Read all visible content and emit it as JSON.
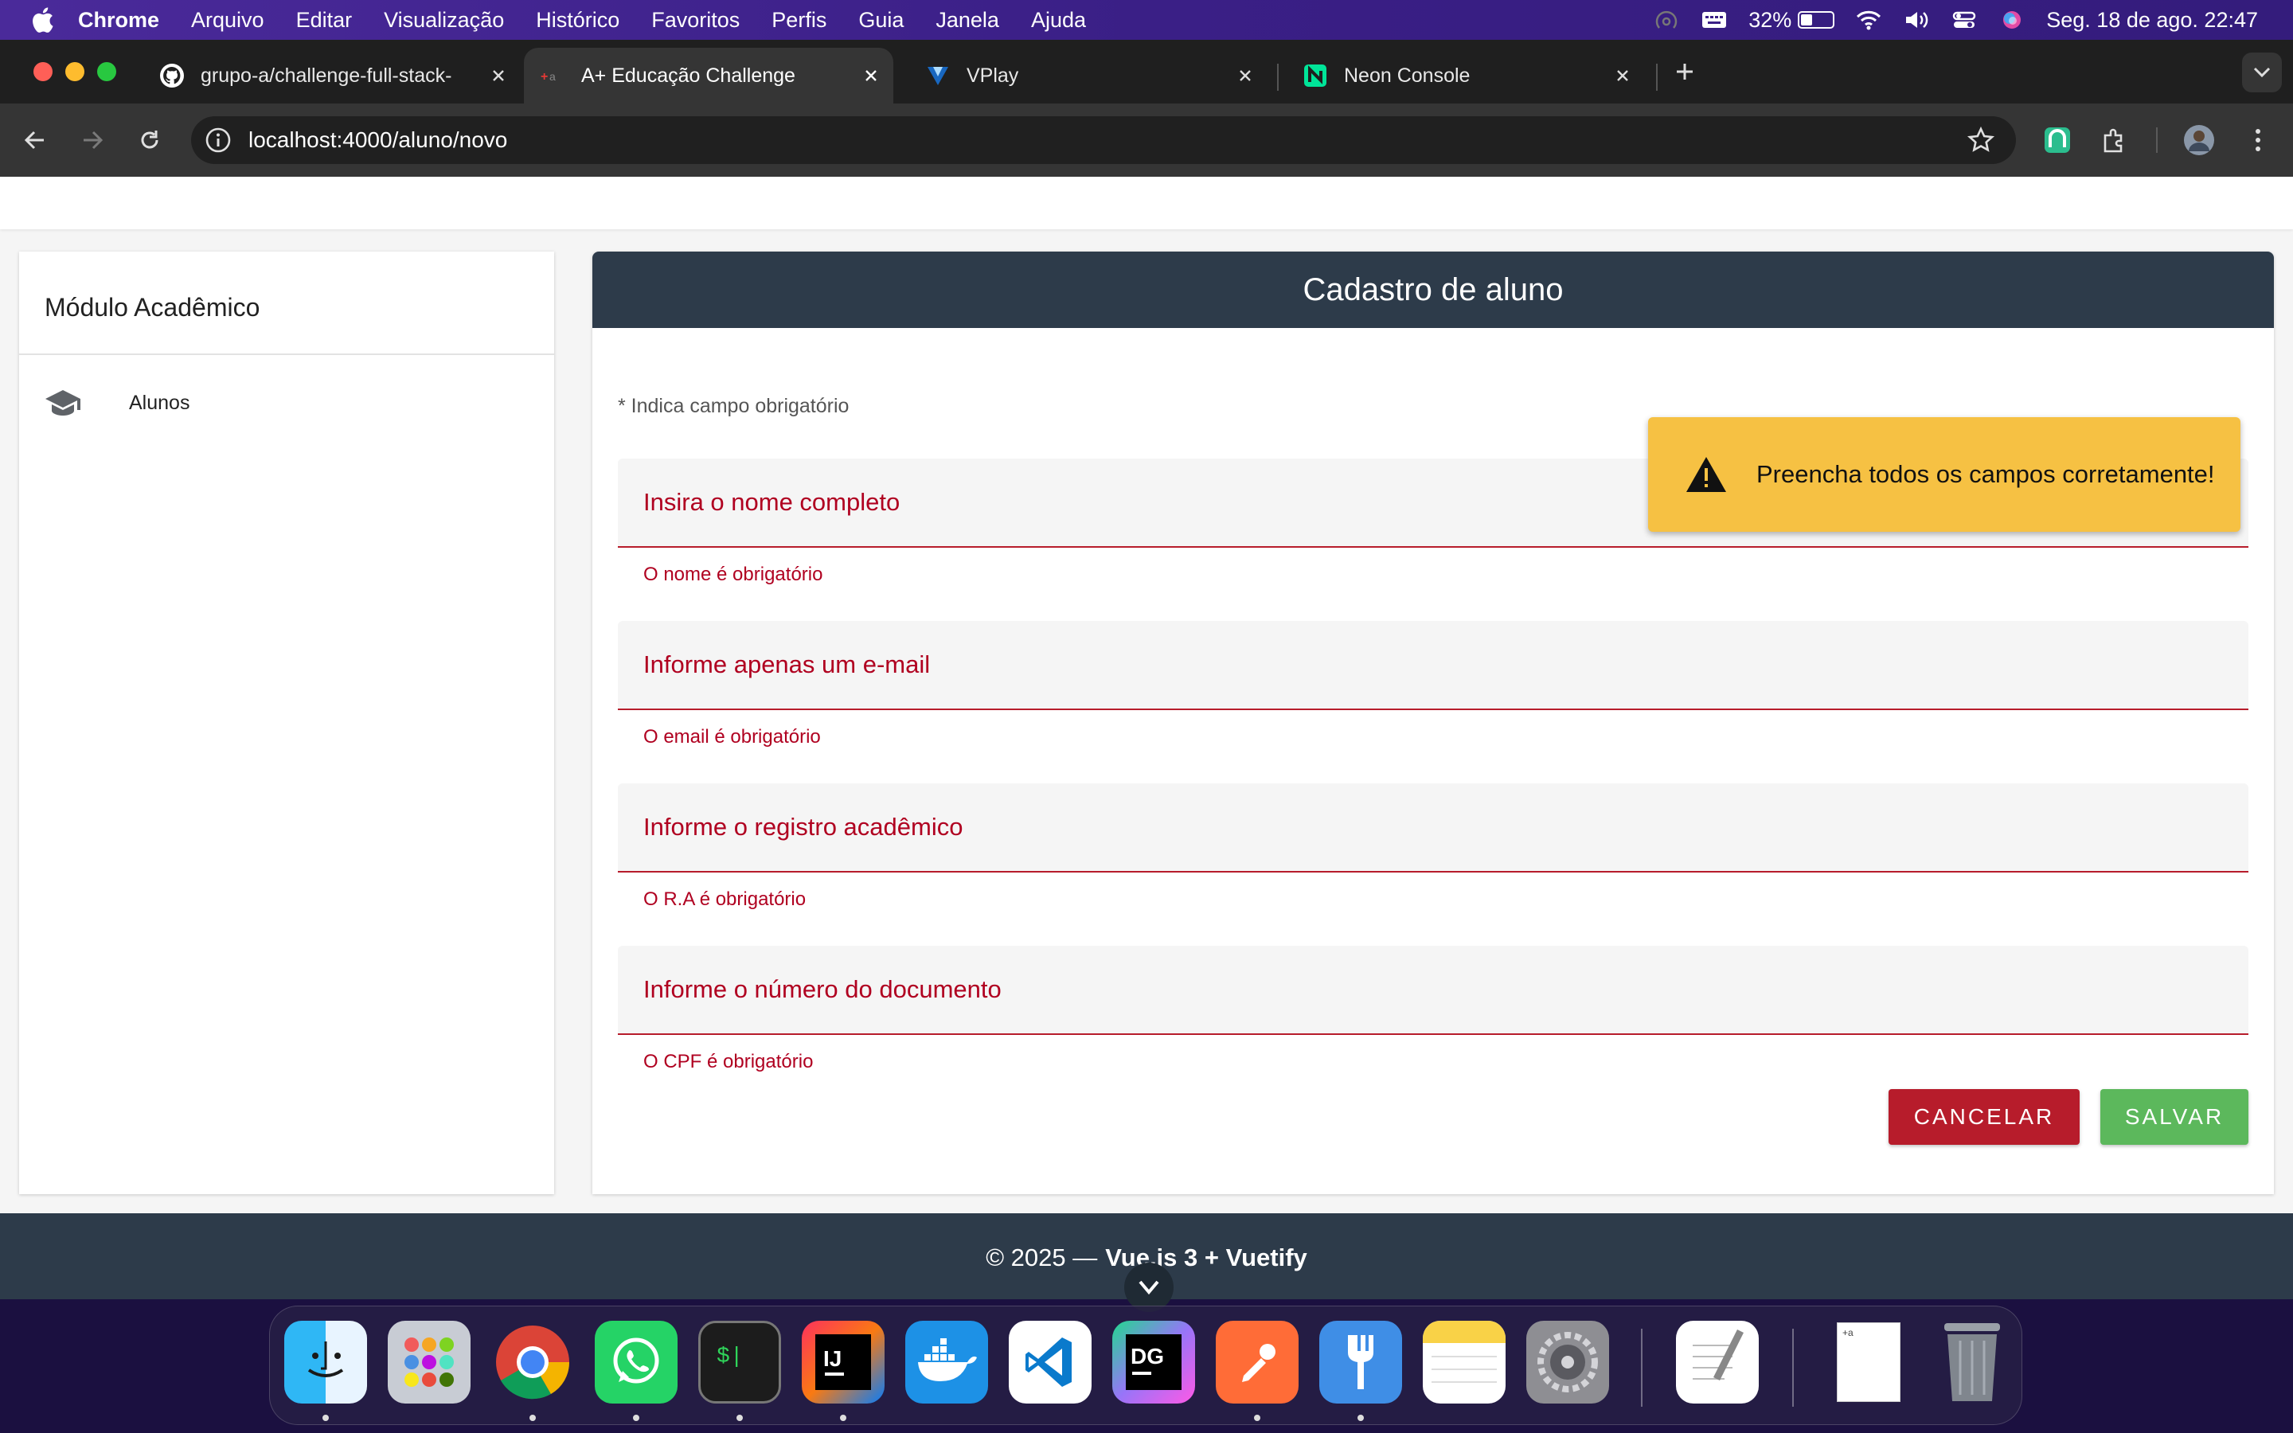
{
  "menubar": {
    "items": [
      "Chrome",
      "Arquivo",
      "Editar",
      "Visualização",
      "Histórico",
      "Favoritos",
      "Perfis",
      "Guia",
      "Janela",
      "Ajuda"
    ],
    "battery_percent": "32%",
    "battery_level": 0.32,
    "clock": "Seg. 18 de ago.  22:47"
  },
  "browser": {
    "tabs": [
      {
        "title": "grupo-a/challenge-full-stack-",
        "icon": "github-icon",
        "active": false
      },
      {
        "title": "A+ Educação Challenge",
        "icon": "site-icon",
        "active": true
      },
      {
        "title": "VPlay",
        "icon": "vuetify-icon",
        "active": false
      },
      {
        "title": "Neon Console",
        "icon": "neon-icon",
        "active": false
      }
    ],
    "url": "localhost:4000/aluno/novo"
  },
  "sidebar": {
    "title": "Módulo Acadêmico",
    "items": [
      {
        "label": "Alunos",
        "icon": "graduation-cap-icon"
      }
    ]
  },
  "form": {
    "title": "Cadastro de aluno",
    "required_note": "* Indica campo obrigatório",
    "fields": [
      {
        "placeholder": "Insira o nome completo",
        "value": "",
        "error": "O nome é obrigatório"
      },
      {
        "placeholder": "Informe apenas um e-mail",
        "value": "",
        "error": "O email é obrigatório"
      },
      {
        "placeholder": "Informe o registro acadêmico",
        "value": "",
        "error": "O R.A é obrigatório"
      },
      {
        "placeholder": "Informe o número do documento",
        "value": "",
        "error": "O CPF é obrigatório"
      }
    ],
    "cancel_label": "CANCELAR",
    "save_label": "SALVAR"
  },
  "snackbar": {
    "message": "Preencha todos os campos corretamente!"
  },
  "footer": {
    "prefix": "© 2025 —",
    "stack": "Vue.js 3 + Vuetify"
  },
  "colors": {
    "header_bg": "#2d3b4a",
    "error": "#b00020",
    "cancel": "#b71c2b",
    "save": "#5cb85c",
    "warning": "#f6c143"
  },
  "dock": {
    "apps": [
      "finder-icon",
      "launchpad-icon",
      "chrome-icon",
      "whatsapp-icon",
      "terminal-icon",
      "intellij-icon",
      "docker-icon",
      "vscode-icon",
      "datagrip-icon",
      "postman-icon",
      "fork-icon",
      "notes-icon",
      "system-settings-icon",
      "textedit-icon",
      "document-icon",
      "trash-icon"
    ]
  }
}
